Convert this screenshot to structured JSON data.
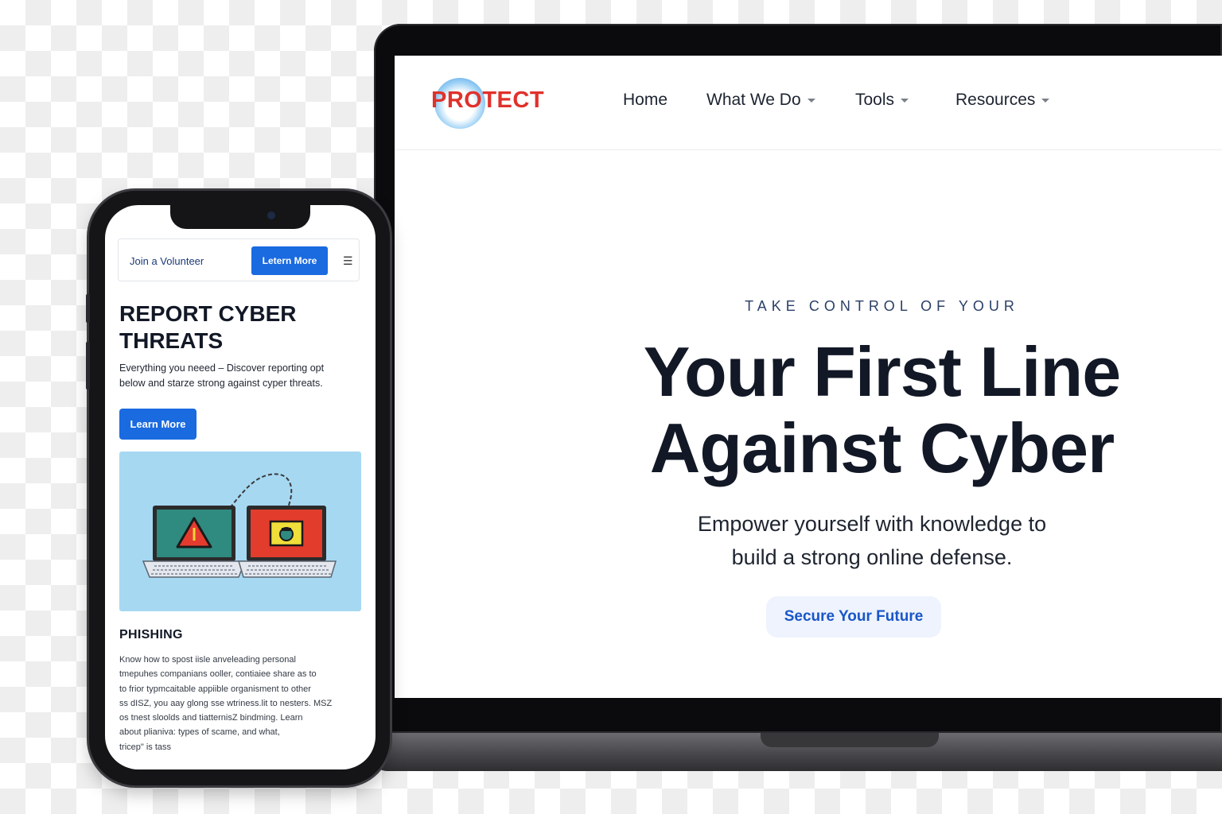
{
  "desktop": {
    "logo_text": "PROTECT",
    "nav": {
      "home": "Home",
      "what_we_do": "What We Do",
      "tools": "Tools",
      "resources": "Resources"
    },
    "hero": {
      "eyebrow": "TAKE CONTROL OF YOUR",
      "title_line1": "Your First Line",
      "title_line2": "Against Cyber",
      "subtitle_line1": "Empower yourself with knowledge to",
      "subtitle_line2": "build a strong online defense.",
      "cta": "Secure Your Future"
    }
  },
  "mobile": {
    "nav": {
      "link": "Join a Volunteer",
      "button": "Letern More",
      "menu_icon": "☰"
    },
    "title_line1": "REPORT CYBER",
    "title_line2": "THREATS",
    "description_line1": "Everything you neeed – Discover reporting opt",
    "description_line2": "below and starze strong against cyper threats.",
    "cta": "Learn More",
    "illustration": "laptops-warning-lock-illustration",
    "section_title": "PHISHING",
    "body_lines": [
      "Know how to spost iisle anveleading personal",
      "tmepuhes companians ooller, contiaiee share as to",
      "to frior typmcaitable appiible organisment to other",
      "ss dISZ, you aay glong sse wtriness.lit to nesters. MSZ",
      "os tnest sloolds and tiatternisZ bindming. Learn",
      "about plianiva: types of scame, and what,",
      "tricep\" is tass"
    ]
  },
  "colors": {
    "logo_red": "#e0312b",
    "primary_blue": "#1a6ae0",
    "cta_text": "#1a56c8",
    "cta_bg": "#eef3fd",
    "illustration_bg": "#a6d8f2",
    "dark_text": "#121826"
  }
}
